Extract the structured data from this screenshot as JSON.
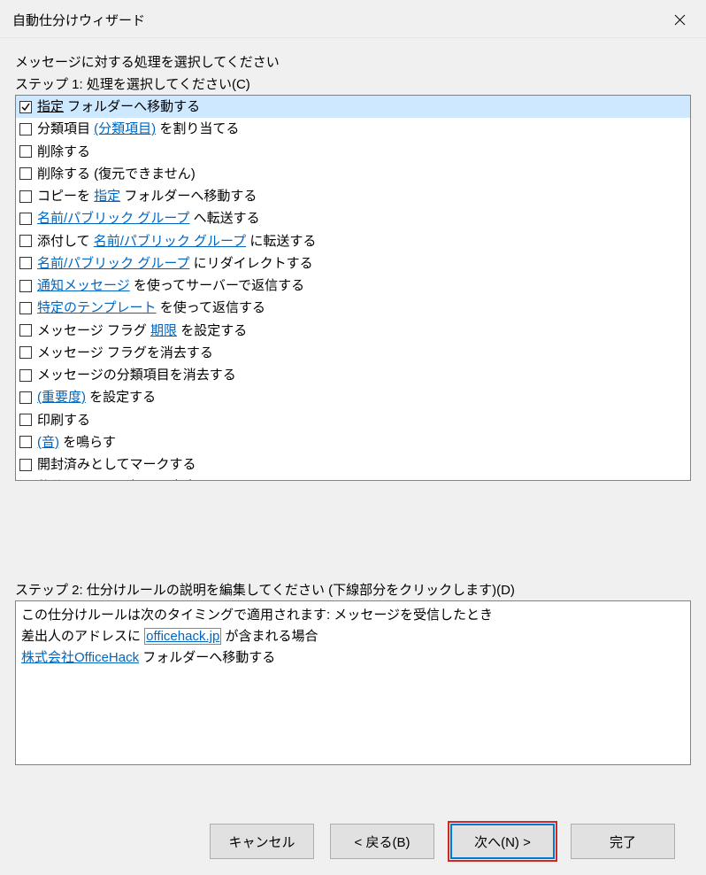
{
  "title": "自動仕分けウィザード",
  "heading": "メッセージに対する処理を選択してください",
  "step1_label": "ステップ 1: 処理を選択してください(C)",
  "actions": [
    {
      "checked": true,
      "selected": true,
      "parts": [
        {
          "t": "link",
          "v": "指定"
        },
        {
          "t": "text",
          "v": " フォルダーへ移動する"
        }
      ]
    },
    {
      "checked": false,
      "selected": false,
      "parts": [
        {
          "t": "text",
          "v": "分類項目 "
        },
        {
          "t": "link",
          "v": "(分類項目)"
        },
        {
          "t": "text",
          "v": " を割り当てる"
        }
      ]
    },
    {
      "checked": false,
      "selected": false,
      "parts": [
        {
          "t": "text",
          "v": "削除する"
        }
      ]
    },
    {
      "checked": false,
      "selected": false,
      "parts": [
        {
          "t": "text",
          "v": "削除する (復元できません)"
        }
      ]
    },
    {
      "checked": false,
      "selected": false,
      "parts": [
        {
          "t": "text",
          "v": "コピーを "
        },
        {
          "t": "link",
          "v": "指定"
        },
        {
          "t": "text",
          "v": " フォルダーへ移動する"
        }
      ]
    },
    {
      "checked": false,
      "selected": false,
      "parts": [
        {
          "t": "link",
          "v": "名前/パブリック グループ"
        },
        {
          "t": "text",
          "v": " へ転送する"
        }
      ]
    },
    {
      "checked": false,
      "selected": false,
      "parts": [
        {
          "t": "text",
          "v": "添付して "
        },
        {
          "t": "link",
          "v": "名前/パブリック グループ"
        },
        {
          "t": "text",
          "v": " に転送する"
        }
      ]
    },
    {
      "checked": false,
      "selected": false,
      "parts": [
        {
          "t": "link",
          "v": "名前/パブリック グループ"
        },
        {
          "t": "text",
          "v": " にリダイレクトする"
        }
      ]
    },
    {
      "checked": false,
      "selected": false,
      "parts": [
        {
          "t": "link",
          "v": "通知メッセージ"
        },
        {
          "t": "text",
          "v": " を使ってサーバーで返信する"
        }
      ]
    },
    {
      "checked": false,
      "selected": false,
      "parts": [
        {
          "t": "link",
          "v": "特定のテンプレート"
        },
        {
          "t": "text",
          "v": " を使って返信する"
        }
      ]
    },
    {
      "checked": false,
      "selected": false,
      "parts": [
        {
          "t": "text",
          "v": "メッセージ フラグ "
        },
        {
          "t": "link",
          "v": "期限"
        },
        {
          "t": "text",
          "v": " を設定する"
        }
      ]
    },
    {
      "checked": false,
      "selected": false,
      "parts": [
        {
          "t": "text",
          "v": "メッセージ フラグを消去する"
        }
      ]
    },
    {
      "checked": false,
      "selected": false,
      "parts": [
        {
          "t": "text",
          "v": "メッセージの分類項目を消去する"
        }
      ]
    },
    {
      "checked": false,
      "selected": false,
      "parts": [
        {
          "t": "link",
          "v": "(重要度)"
        },
        {
          "t": "text",
          "v": " を設定する"
        }
      ]
    },
    {
      "checked": false,
      "selected": false,
      "parts": [
        {
          "t": "text",
          "v": "印刷する"
        }
      ]
    },
    {
      "checked": false,
      "selected": false,
      "parts": [
        {
          "t": "link",
          "v": "(音)"
        },
        {
          "t": "text",
          "v": " を鳴らす"
        }
      ]
    },
    {
      "checked": false,
      "selected": false,
      "parts": [
        {
          "t": "text",
          "v": "開封済みとしてマークする"
        }
      ]
    },
    {
      "checked": false,
      "selected": false,
      "parts": [
        {
          "t": "text",
          "v": "仕分けルールの処理を中止する"
        }
      ]
    }
  ],
  "step2_label": "ステップ 2: 仕分けルールの説明を編集してください (下線部分をクリックします)(D)",
  "desc": {
    "line1": "この仕分けルールは次のタイミングで適用されます: メッセージを受信したとき",
    "line2_a": "差出人のアドレスに ",
    "line2_link": "officehack.jp",
    "line2_b": " が含まれる場合",
    "line3_link": "株式会社OfficeHack",
    "line3_b": " フォルダーへ移動する"
  },
  "buttons": {
    "cancel": "キャンセル",
    "back": "< 戻る(B)",
    "next": "次へ(N) >",
    "finish": "完了"
  }
}
